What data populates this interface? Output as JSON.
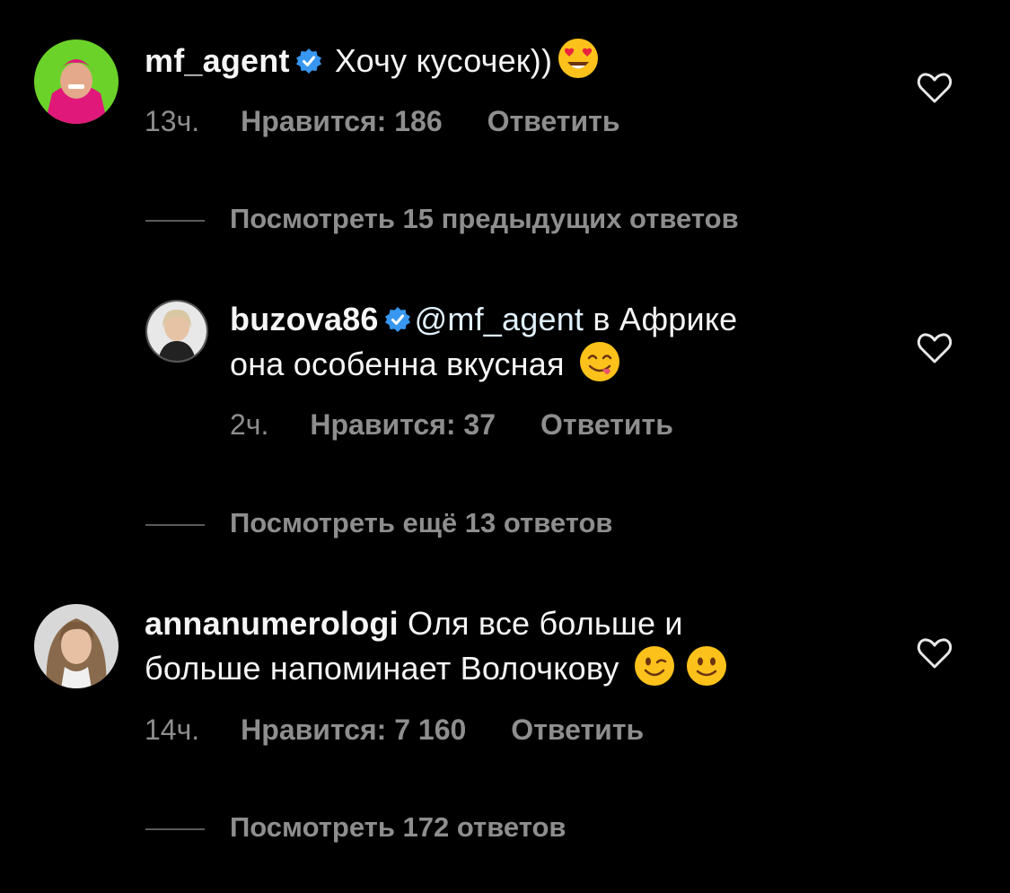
{
  "colors": {
    "background": "#000000",
    "text": "#f5f5f5",
    "secondary": "#8e8e8e",
    "verified": "#3897f0",
    "mention": "#e0f1ff"
  },
  "comments": [
    {
      "username": "mf_agent",
      "verified": true,
      "text": " Хочу кусочек))",
      "emoji": [
        "heart-eyes-emoji"
      ],
      "time": "13ч.",
      "likes": "Нравится: 186",
      "reply": "Ответить",
      "view_replies": "Посмотреть 15 предыдущих ответов"
    },
    {
      "username": "buzova86",
      "verified": true,
      "mention": "@mf_agent",
      "text_line1": " в Африке",
      "text_line2": "она особенна вкусная",
      "emoji": [
        "yum-emoji"
      ],
      "time": "2ч.",
      "likes": "Нравится: 37",
      "reply": "Ответить",
      "view_replies": "Посмотреть ещё 13 ответов"
    },
    {
      "username": "annanumerologi",
      "verified": false,
      "text_line1": " Оля все больше и",
      "text_line2": "больше  напоминает Волочкову",
      "emoji": [
        "wink-emoji",
        "slight-smile-emoji"
      ],
      "time": "14ч.",
      "likes": "Нравится: 7 160",
      "reply": "Ответить",
      "view_replies": "Посмотреть 172 ответов"
    }
  ]
}
